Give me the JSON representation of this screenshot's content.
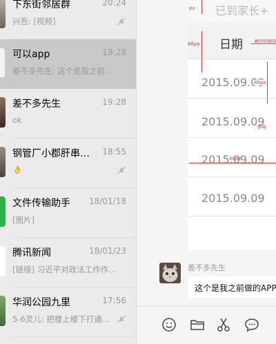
{
  "conversations": [
    {
      "name": "下东街邻居群",
      "time": "20:24",
      "preview": "兴吾: [视频]",
      "muted": true
    },
    {
      "name": "可以app",
      "time": "19:28",
      "preview": "差不多先生: 这个是我之前做的...",
      "muted": false,
      "selected": true
    },
    {
      "name": "差不多先生",
      "time": "19:28",
      "preview": "ok",
      "muted": false
    },
    {
      "name": "钢管厂小郡肝串串...",
      "time": "18:55",
      "preview": "👌",
      "muted": true
    },
    {
      "name": "文件传输助手",
      "time": "18/01/18",
      "preview": "[图片]",
      "muted": false
    },
    {
      "name": "腾讯新闻",
      "time": "18/01/23",
      "preview": "[链接] 习近平对政法工作作出...",
      "muted": false
    },
    {
      "name": "华润公园九里",
      "time": "17:56",
      "preview": "5-6灵儿: 把楼上楼下打通...",
      "muted": true
    }
  ],
  "screenshot": {
    "header": "已到家长+",
    "column": "日期",
    "dates": [
      "2015.09.09",
      "2015.09.09",
      "2015.09.09",
      "2015.09.09"
    ],
    "annotations": [
      "px",
      "86px",
      "#000000",
      "86px",
      "字号",
      "40px"
    ]
  },
  "message": {
    "sender": "差不多先生",
    "text": "这个是我之前做的APP"
  },
  "toolbar": [
    "emoji-icon",
    "folder-icon",
    "scissors-icon",
    "chat-bubble-icon"
  ]
}
